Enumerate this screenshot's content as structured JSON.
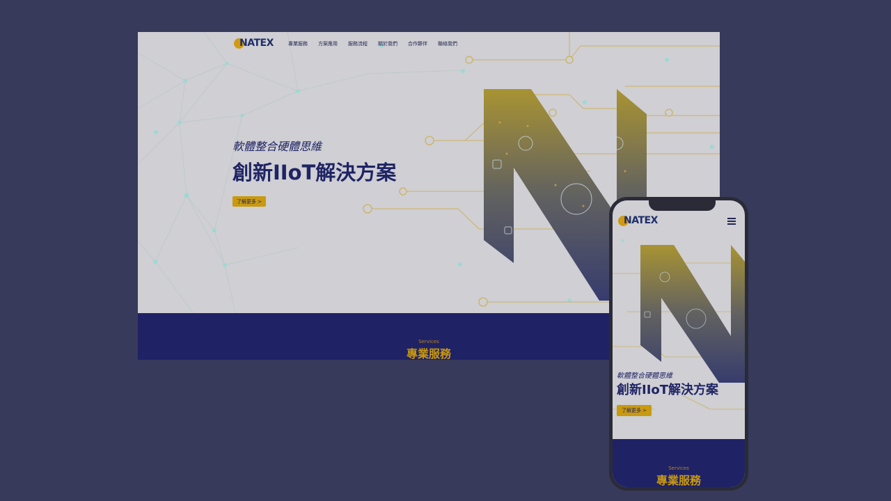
{
  "brand": {
    "name": "NATEX"
  },
  "nav": {
    "items": [
      "專業服務",
      "方案應用",
      "服務流程",
      "關於我們",
      "合作夥伴",
      "聯絡我們"
    ]
  },
  "hero": {
    "tagline": "軟體整合硬體思維",
    "headline": "創新IIoT解決方案",
    "cta_label": "了解更多 >"
  },
  "services": {
    "en_label": "Services",
    "title": "專業服務"
  },
  "icons": {
    "menu": "hamburger-menu-icon",
    "logo_mark": "natex-logo-mark",
    "hero_graphic": "n-circuit-graphic"
  },
  "colors": {
    "page_bg": "#373a5a",
    "navy": "#1f2265",
    "gold": "#c9990f",
    "hero_bg": "#cfcfd4",
    "text_navy": "#1f2464"
  }
}
